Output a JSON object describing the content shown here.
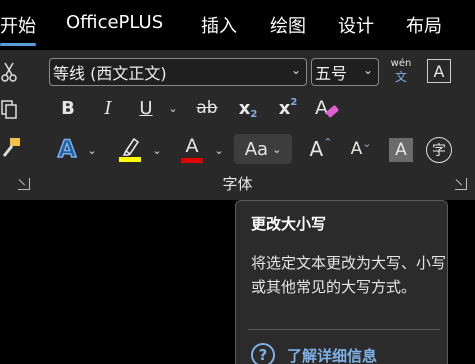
{
  "tabs": [
    {
      "label": "开始",
      "active": true
    },
    {
      "label": "OfficePLUS"
    },
    {
      "label": "插入"
    },
    {
      "label": "绘图"
    },
    {
      "label": "设计"
    },
    {
      "label": "布局"
    }
  ],
  "font": {
    "font_name": "等线 (西文正文)",
    "font_size": "五号",
    "phonetic_top": "wén",
    "phonetic_bottom": "文",
    "border_char_label": "A",
    "bold": "B",
    "italic": "I",
    "underline": "U",
    "strikethrough": "ab",
    "subscript": "x",
    "subscript_mark": "2",
    "superscript": "x",
    "superscript_mark": "2",
    "text_effects": "A",
    "highlight_color": "#ffff00",
    "font_color_label": "A",
    "font_color": "#e00000",
    "change_case": "Aa",
    "grow_font": "A",
    "shrink_font": "A",
    "char_shading": "A",
    "enclose_char": "字",
    "group_label": "字体"
  },
  "tooltip": {
    "title": "更改大小写",
    "body": "将选定文本更改为大写、小写或其他常见的大写方式。",
    "help_icon": "?",
    "help_link": "了解详细信息"
  }
}
